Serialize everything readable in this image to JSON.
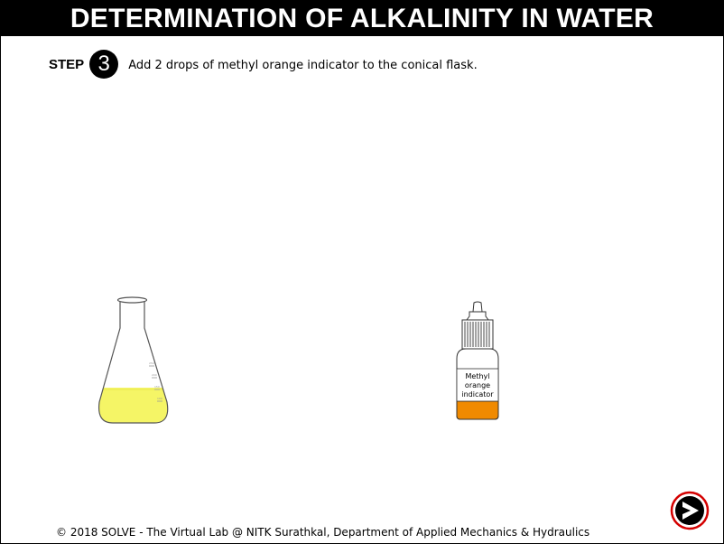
{
  "header": {
    "title": "DETERMINATION OF ALKALINITY IN WATER"
  },
  "step": {
    "label": "STEP",
    "number": "3",
    "instruction": "Add 2 drops of methyl orange indicator to the conical flask."
  },
  "apparatus": {
    "flask": {
      "liquid_color": "#f5f566"
    },
    "bottle": {
      "label_lines": [
        "Methyl",
        "orange",
        "indicator"
      ],
      "liquid_color": "#f08a00"
    }
  },
  "footer": {
    "text": "© 2018 SOLVE - The Virtual Lab @ NITK Surathkal, Department of Applied Mechanics & Hydraulics"
  },
  "navigation": {
    "next_icon": "arrow-right-icon",
    "ring_color": "#d40000"
  }
}
